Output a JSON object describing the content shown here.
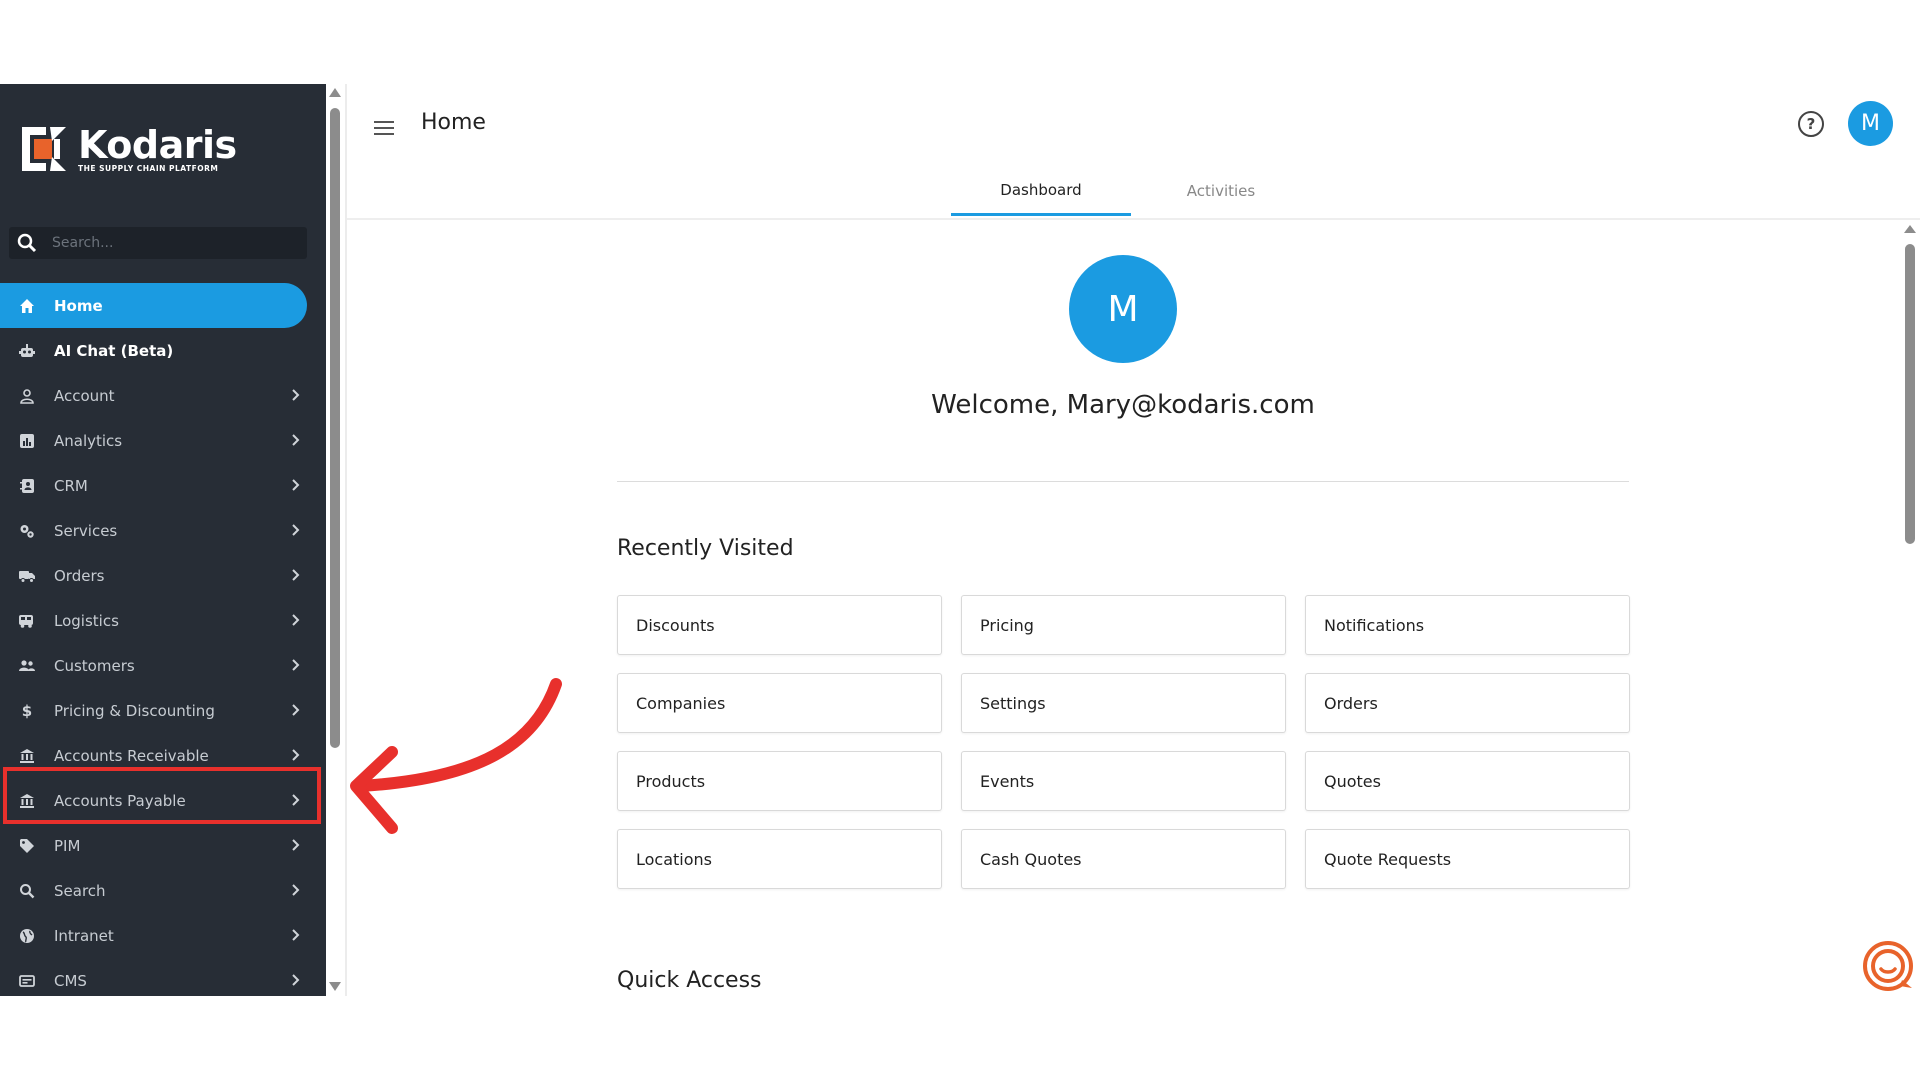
{
  "brand": {
    "name": "Kodaris",
    "tagline": "THE SUPPLY CHAIN PLATFORM"
  },
  "sidebar": {
    "search_placeholder": "Search...",
    "items": [
      {
        "label": "Home",
        "icon": "home-icon",
        "state": "active",
        "chevron": false
      },
      {
        "label": "AI Chat (Beta)",
        "icon": "robot-icon",
        "state": "bold",
        "chevron": false
      },
      {
        "label": "Account",
        "icon": "user-icon",
        "chevron": true
      },
      {
        "label": "Analytics",
        "icon": "chart-icon",
        "chevron": true
      },
      {
        "label": "CRM",
        "icon": "contacts-icon",
        "chevron": true
      },
      {
        "label": "Services",
        "icon": "gears-icon",
        "chevron": true
      },
      {
        "label": "Orders",
        "icon": "truck-icon",
        "chevron": true
      },
      {
        "label": "Logistics",
        "icon": "bus-icon",
        "chevron": true
      },
      {
        "label": "Customers",
        "icon": "people-icon",
        "chevron": true
      },
      {
        "label": "Pricing & Discounting",
        "icon": "dollar-icon",
        "chevron": true,
        "highlighted": true
      },
      {
        "label": "Accounts Receivable",
        "icon": "bank-icon",
        "chevron": true
      },
      {
        "label": "Accounts Payable",
        "icon": "bank-icon",
        "chevron": true
      },
      {
        "label": "PIM",
        "icon": "tag-icon",
        "chevron": true
      },
      {
        "label": "Search",
        "icon": "search-icon",
        "chevron": true
      },
      {
        "label": "Intranet",
        "icon": "globe-icon",
        "chevron": true
      },
      {
        "label": "CMS",
        "icon": "cms-icon",
        "chevron": true
      }
    ]
  },
  "header": {
    "title": "Home",
    "avatar_initial": "M",
    "help_icon": "help-icon",
    "tabs": [
      {
        "label": "Dashboard",
        "active": true
      },
      {
        "label": "Activities",
        "active": false
      }
    ]
  },
  "main": {
    "avatar_initial": "M",
    "welcome": "Welcome, Mary@kodaris.com",
    "recently_visited_title": "Recently Visited",
    "recently_visited": [
      "Discounts",
      "Pricing",
      "Notifications",
      "Companies",
      "Settings",
      "Orders",
      "Products",
      "Events",
      "Quotes",
      "Locations",
      "Cash Quotes",
      "Quote Requests"
    ],
    "quick_access_title": "Quick Access"
  },
  "colors": {
    "accent": "#1b9be1",
    "sidebar_bg": "#272d36",
    "annotation": "#e8302c",
    "logo_orange": "#e8632b"
  }
}
